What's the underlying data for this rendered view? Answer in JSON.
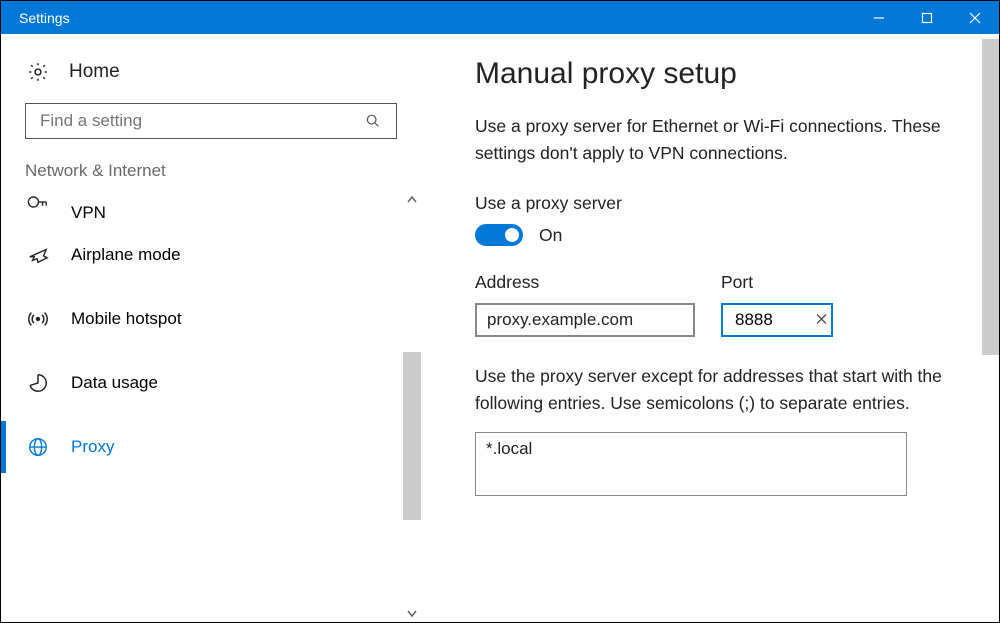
{
  "window": {
    "title": "Settings"
  },
  "sidebar": {
    "home_label": "Home",
    "search_placeholder": "Find a setting",
    "section_label": "Network & Internet",
    "items": [
      {
        "icon": "vpn-lock-icon",
        "label": "VPN",
        "truncated_top": true
      },
      {
        "icon": "airplane-icon",
        "label": "Airplane mode"
      },
      {
        "icon": "hotspot-icon",
        "label": "Mobile hotspot"
      },
      {
        "icon": "data-usage-icon",
        "label": "Data usage"
      },
      {
        "icon": "globe-icon",
        "label": "Proxy",
        "selected": true
      }
    ]
  },
  "main": {
    "title": "Manual proxy setup",
    "description": "Use a proxy server for Ethernet or Wi-Fi connections. These settings don't apply to VPN connections.",
    "use_proxy_label": "Use a proxy server",
    "toggle_state": "On",
    "address_label": "Address",
    "address_value": "proxy.example.com",
    "port_label": "Port",
    "port_value": "8888",
    "exceptions_description": "Use the proxy server except for addresses that start with the following entries. Use semicolons (;) to separate entries.",
    "exceptions_value": "*.local"
  }
}
